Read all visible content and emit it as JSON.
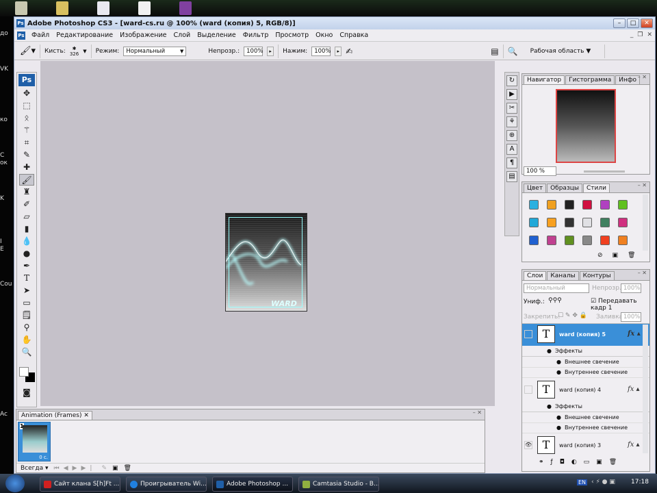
{
  "window": {
    "title": "Adobe Photoshop CS3 - [ward-cs.ru @ 100% (ward (копия) 5, RGB/8)]",
    "app_icon": "Ps"
  },
  "menu": [
    "Файл",
    "Редактирование",
    "Изображение",
    "Слой",
    "Выделение",
    "Фильтр",
    "Просмотр",
    "Окно",
    "Справка"
  ],
  "options": {
    "brush_label": "Кисть:",
    "brush_size": "326",
    "mode_label": "Режим:",
    "mode_value": "Нормальный",
    "opacity_label": "Непрозр.:",
    "opacity_value": "100%",
    "flow_label": "Нажим:",
    "flow_value": "100%",
    "workspace": "Рабочая область ▼"
  },
  "toolbox": {
    "logo": "Ps",
    "tools": [
      "move",
      "marquee",
      "lasso",
      "magic-wand",
      "crop",
      "slice",
      "healing",
      "brush",
      "stamp",
      "history-brush",
      "eraser",
      "gradient",
      "blur",
      "dodge",
      "pen",
      "type",
      "path-select",
      "shape",
      "notes",
      "eyedropper",
      "hand",
      "zoom"
    ]
  },
  "desktop_labels": [
    "до",
    "VK",
    "ко",
    "C",
    "ок",
    "K",
    "I",
    "E",
    "Cou",
    "Ac"
  ],
  "navigator": {
    "tabs": [
      "Навигатор",
      "Гистограмма",
      "Инфо"
    ],
    "zoom": "100 %"
  },
  "styles": {
    "tabs": [
      "Цвет",
      "Образцы",
      "Стили"
    ],
    "swatches": [
      "#2ab0e0",
      "#f0a020",
      "#222222",
      "#d01040",
      "#b040c0",
      "#60c020",
      "#20a8d8",
      "#f8a020",
      "#333333",
      "#e0e0e4",
      "#408060",
      "#d03080",
      "#2060d0",
      "#c04090",
      "#609020",
      "#888888",
      "#f04020",
      "#f08020"
    ]
  },
  "layers": {
    "tabs": [
      "Слои",
      "Каналы",
      "Контуры"
    ],
    "blend": "Нормальный",
    "opacity_label": "Непрозр.:",
    "opacity": "100%",
    "unify_label": "Униф.:",
    "propagate": "Передавать кадр 1",
    "lock_label": "Закрепить:",
    "fill_label": "Заливка:",
    "fill": "100%",
    "items": [
      {
        "name": "ward (копия) 5",
        "selected": true,
        "visible": false,
        "effects": "Эффекты",
        "fx": [
          "Внешнее свечение",
          "Внутреннее свечение"
        ]
      },
      {
        "name": "ward (копия) 4",
        "selected": false,
        "visible": false,
        "effects": "Эффекты",
        "fx": [
          "Внешнее свечение",
          "Внутреннее свечение"
        ]
      },
      {
        "name": "ward (копия) 3",
        "selected": false,
        "visible": true,
        "effects": "Эффекты",
        "fx": []
      }
    ]
  },
  "animation": {
    "tab": "Animation (Frames)",
    "frame_number": "1",
    "frame_delay": "0 с.",
    "loop": "Всегда"
  },
  "taskbar": {
    "items": [
      "Сайт клана S[h]Ft ...",
      "Проигрыватель Wi...",
      "Adobe Photoshop ...",
      "Camtasia Studio - B..."
    ],
    "lang": "EN",
    "clock": "17:18"
  },
  "colors": {
    "accent": "#3a8fd8",
    "canvas_bg": "#c5c1c9",
    "glow": "#a0ffff"
  }
}
